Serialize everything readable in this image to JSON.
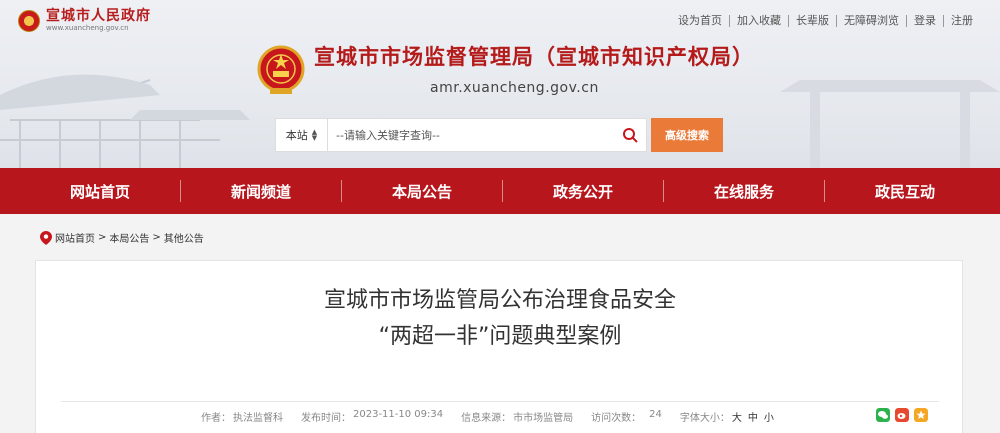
{
  "gov": {
    "title": "宣城市人民政府",
    "url": "www.xuancheng.gov.cn"
  },
  "top_links": [
    "设为首页",
    "加入收藏",
    "长辈版",
    "无障碍浏览",
    "登录",
    "注册"
  ],
  "site": {
    "title": "宣城市市场监督管理局（宣城市知识产权局）",
    "domain": "amr.xuancheng.gov.cn"
  },
  "search": {
    "scope": "本站",
    "placeholder": "--请输入关键字查询--",
    "advanced_label": "高级搜索"
  },
  "nav": [
    {
      "label": "网站首页"
    },
    {
      "label": "新闻频道"
    },
    {
      "label": "本局公告"
    },
    {
      "label": "政务公开"
    },
    {
      "label": "在线服务"
    },
    {
      "label": "政民互动"
    }
  ],
  "breadcrumb": [
    "网站首页",
    "本局公告",
    "其他公告"
  ],
  "breadcrumb_sep": ">",
  "article": {
    "title_line1": "宣城市市场监管局公布治理食品安全",
    "title_line2": "“两超一非”问题典型案例",
    "author_label": "作者：",
    "author": "执法监督科",
    "time_label": "发布时间：",
    "time": "2023-11-10 09:34",
    "source_label": "信息来源：",
    "source": "市市场监管局",
    "visits_label": "访问次数：",
    "visits": "24",
    "fontsize_label": "字体大小：",
    "fontsize_options": [
      "大",
      "中",
      "小"
    ]
  },
  "colors": {
    "brand_red": "#b7161d",
    "accent_orange": "#ea7a38"
  }
}
